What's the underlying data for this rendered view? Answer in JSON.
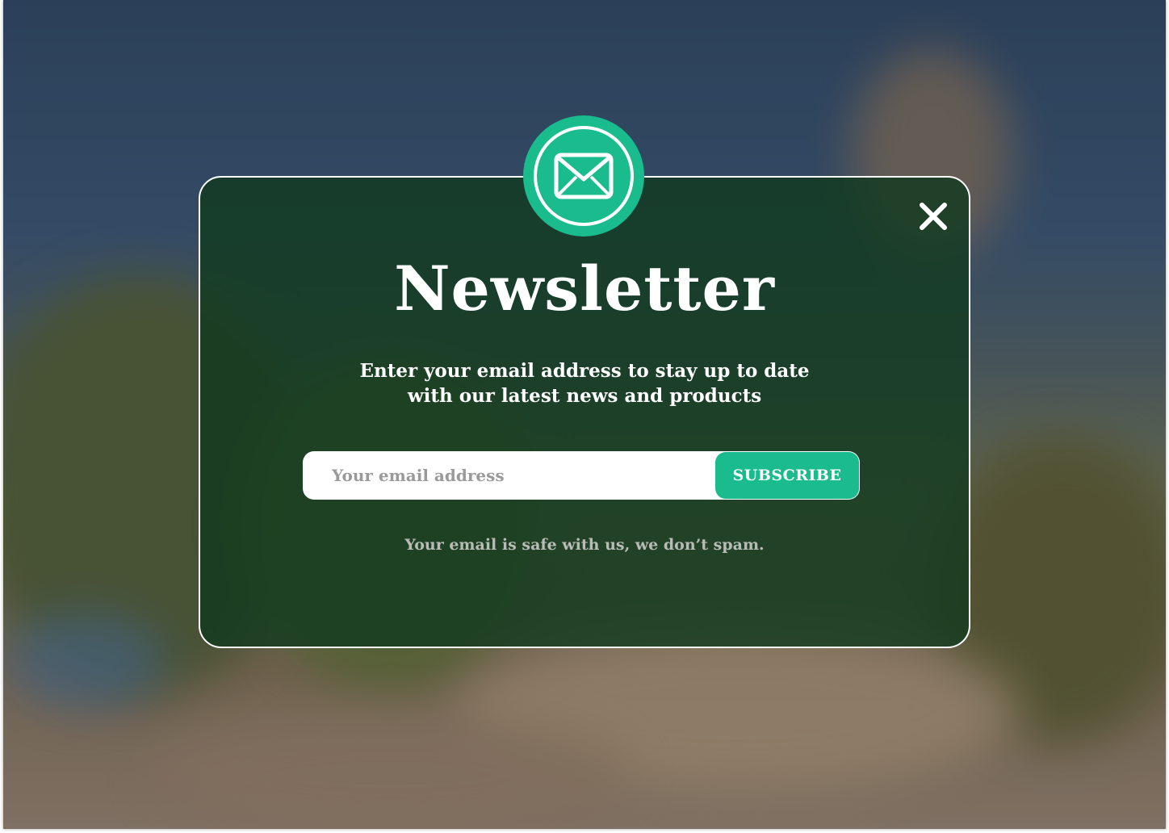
{
  "modal": {
    "title": "Newsletter",
    "subtitle_line1": "Enter your email address to stay up to date",
    "subtitle_line2": "with our latest news and products",
    "email_placeholder": "Your email address",
    "subscribe_label": "SUBSCRIBE",
    "disclaimer": "Your email is safe with us, we don’t spam.",
    "mail_icon": "envelope-icon",
    "close_icon": "close-icon"
  },
  "colors": {
    "accent": "#1abc8e",
    "modal_background": "#103a1e",
    "text": "#ffffff",
    "muted_text": "#b9bcb6"
  }
}
